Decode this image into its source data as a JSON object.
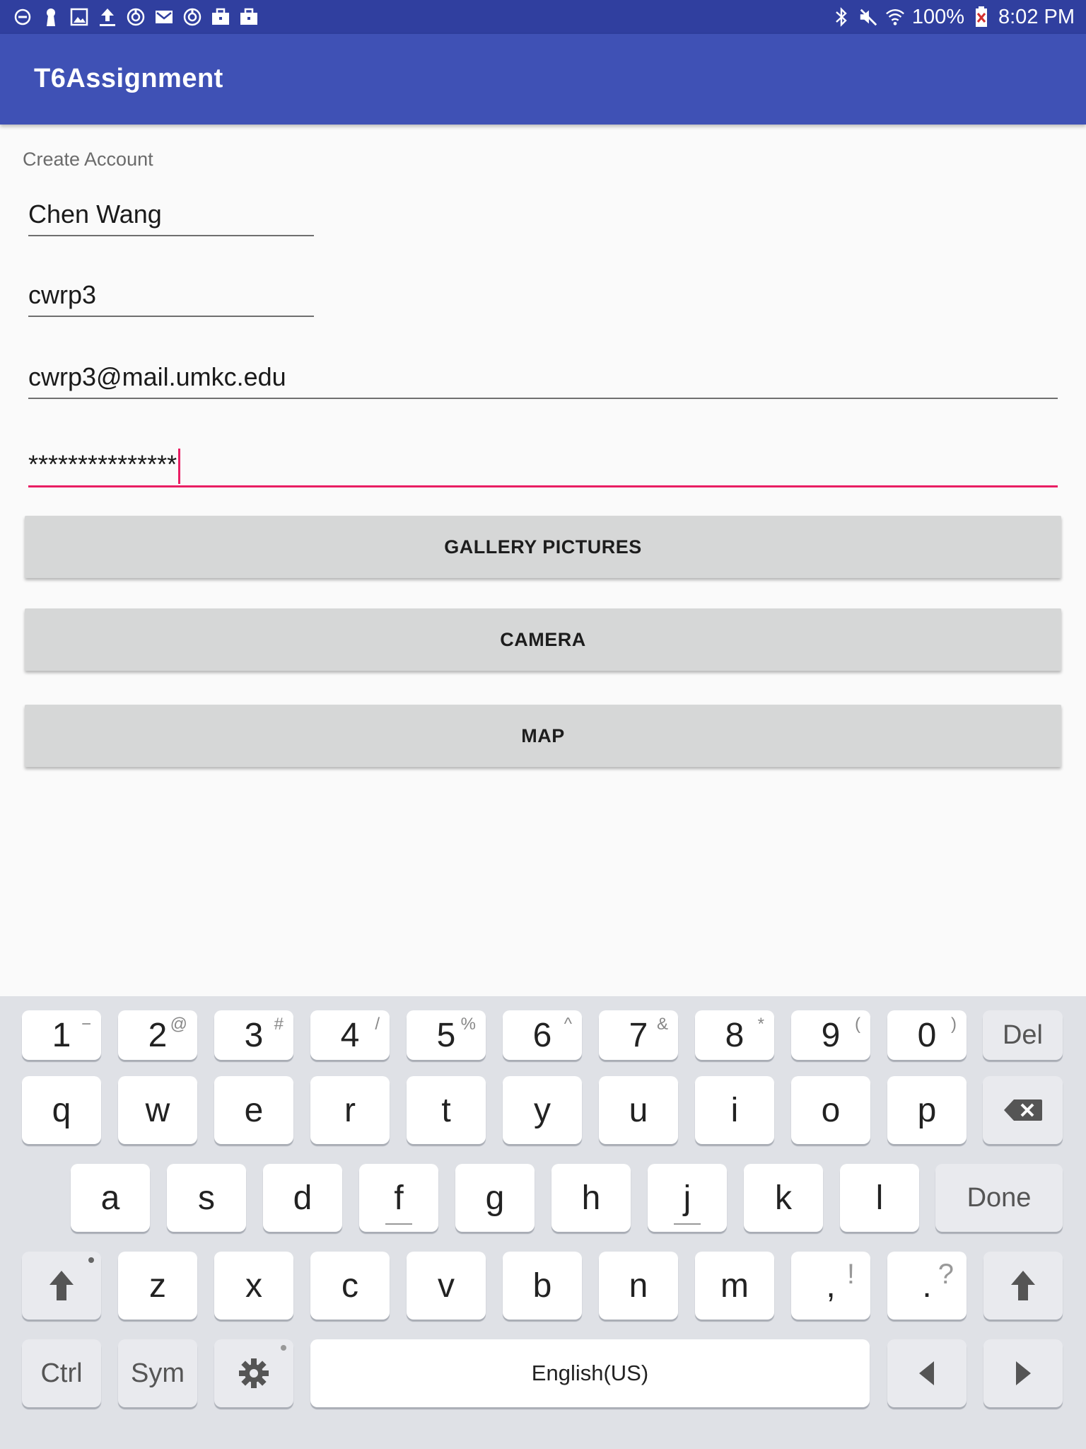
{
  "status_bar": {
    "left_icons": [
      "do-not-disturb-icon",
      "keyhole-icon",
      "image-icon",
      "upload-icon",
      "sync-icon",
      "gmail-icon",
      "sync-icon",
      "briefcase-icon",
      "briefcase-icon"
    ],
    "right_icons": [
      "bluetooth-icon",
      "mute-icon",
      "wifi-icon"
    ],
    "battery": "100%",
    "time": "8:02 PM"
  },
  "app_bar": {
    "title": "T6Assignment"
  },
  "form": {
    "label": "Create Account",
    "name": "Chen Wang",
    "username": "cwrp3",
    "email": "cwrp3@mail.umkc.edu",
    "password_masked": "***************"
  },
  "buttons": {
    "gallery": "GALLERY PICTURES",
    "camera": "CAMERA",
    "map": "MAP"
  },
  "keyboard": {
    "number_row": [
      {
        "k": "1",
        "s": "−"
      },
      {
        "k": "2",
        "s": "@"
      },
      {
        "k": "3",
        "s": "#"
      },
      {
        "k": "4",
        "s": "/"
      },
      {
        "k": "5",
        "s": "%"
      },
      {
        "k": "6",
        "s": "^"
      },
      {
        "k": "7",
        "s": "&"
      },
      {
        "k": "8",
        "s": "*"
      },
      {
        "k": "9",
        "s": "("
      },
      {
        "k": "0",
        "s": ")"
      }
    ],
    "del": "Del",
    "row1": [
      "q",
      "w",
      "e",
      "r",
      "t",
      "y",
      "u",
      "i",
      "o",
      "p"
    ],
    "row2": [
      "a",
      "s",
      "d",
      "f",
      "g",
      "h",
      "j",
      "k",
      "l"
    ],
    "done": "Done",
    "row3": [
      "z",
      "x",
      "c",
      "v",
      "b",
      "n",
      "m"
    ],
    "comma": ",",
    "comma_alt": "!",
    "period": ".",
    "period_alt": "?",
    "ctrl": "Ctrl",
    "sym": "Sym",
    "space": "English(US)"
  }
}
